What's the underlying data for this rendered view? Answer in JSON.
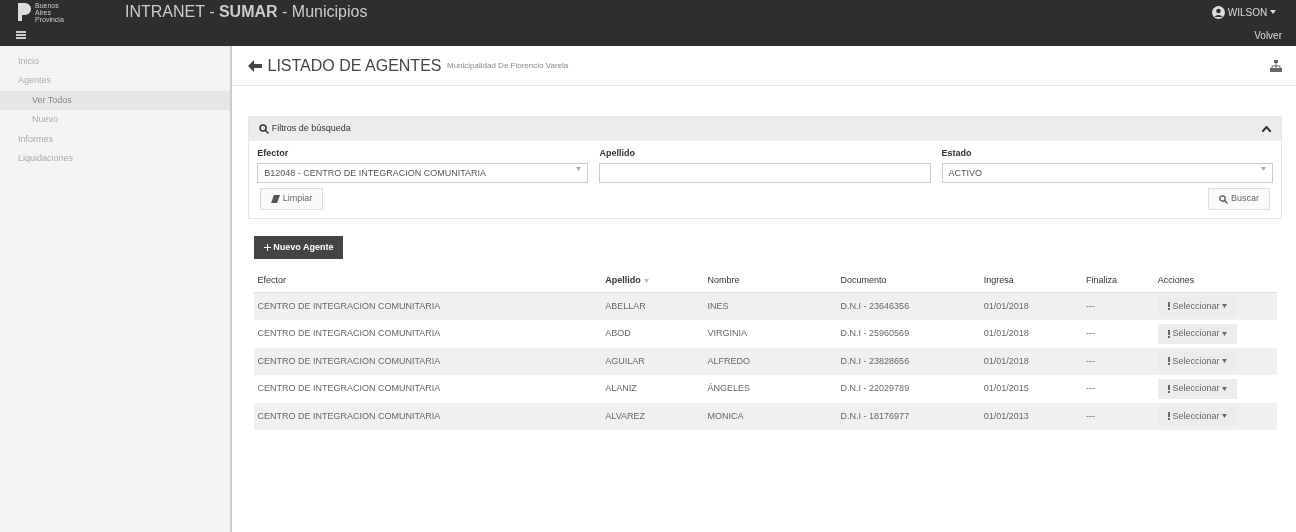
{
  "header": {
    "logo_text": "Buenos Aires Provincia",
    "title": "INTRANET - **SUMAR** - Municipios",
    "user": "WILSON",
    "back_link": "Volver"
  },
  "sidebar": {
    "items": [
      {
        "label": "Inicio",
        "selected": false
      },
      {
        "label": "Agentes",
        "selected": false,
        "children": [
          {
            "label": "Ver Todos",
            "selected": true
          },
          {
            "label": "Nuevo",
            "selected": false
          }
        ]
      },
      {
        "label": "Informes",
        "selected": false
      },
      {
        "label": "Liquidaciones",
        "selected": false
      }
    ]
  },
  "page": {
    "title": "LISTADO DE AGENTES",
    "subtitle": "Municipalidad De Florencio Varela"
  },
  "filters": {
    "title": "Filtros de búsqueda",
    "expanded": true,
    "fields": [
      {
        "label": "Efector",
        "kind": "select",
        "value": "B12048 - CENTRO DE INTEGRACION COMUNITARIA"
      },
      {
        "label": "Apellido",
        "kind": "text"
      },
      {
        "label": "Estado",
        "kind": "select",
        "value": "ACTIVO"
      }
    ],
    "clear_button": "Limpiar",
    "search_button": "Buscar"
  },
  "new_button": "Nuevo Agente",
  "table": {
    "columns": [
      {
        "label": "Efector",
        "sorted": false
      },
      {
        "label": "Apellido",
        "sorted": true
      },
      {
        "label": "Nombre",
        "sorted": false
      },
      {
        "label": "Documento",
        "sorted": false
      },
      {
        "label": "Ingresa",
        "sorted": false
      },
      {
        "label": "Finaliza",
        "sorted": false
      },
      {
        "label": "Acciones",
        "sorted": false
      }
    ],
    "rows": [
      {
        "cells": [
          "CENTRO DE INTEGRACION COMUNITARIA",
          "ABELLAR",
          "INES",
          "D.N.I - 23646356",
          "01/01/2018",
          "---"
        ],
        "action": "Seleccionar"
      },
      {
        "cells": [
          "CENTRO DE INTEGRACION COMUNITARIA",
          "ABOD",
          "VIRGINIA",
          "D.N.I - 25960569",
          "01/01/2018",
          "---"
        ],
        "action": "Seleccionar"
      },
      {
        "cells": [
          "CENTRO DE INTEGRACION COMUNITARIA",
          "AGUILAR",
          "ALFREDO",
          "D.N.I - 23828656",
          "01/01/2018",
          "---"
        ],
        "action": "Seleccionar"
      },
      {
        "cells": [
          "CENTRO DE INTEGRACION COMUNITARIA",
          "ALANIZ",
          "ÁNGELES",
          "D.N.I - 22029789",
          "01/01/2015",
          "---"
        ],
        "action": "Seleccionar"
      },
      {
        "cells": [
          "CENTRO DE INTEGRACION COMUNITARIA",
          "ALVAREZ",
          "MONICA",
          "D.N.I - 18176977",
          "01/01/2013",
          "---"
        ],
        "action": "Seleccionar"
      }
    ]
  }
}
